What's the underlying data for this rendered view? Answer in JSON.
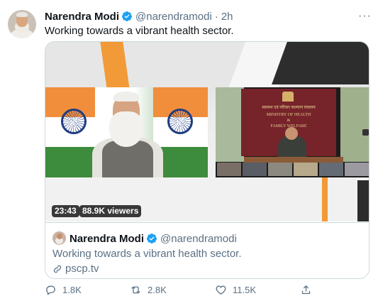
{
  "tweet": {
    "name": "Narendra Modi",
    "handle": "@narendramodi",
    "separator": "·",
    "time": "2h",
    "text": "Working towards a vibrant health sector.",
    "more_label": "···"
  },
  "media": {
    "duration": "23:43",
    "viewers": "88.9K viewers",
    "board_lines": [
      "स्वास्थ्य एवं परिवार कल्याण मंत्रालय",
      "MINISTRY OF HEALTH",
      "&",
      "FAMILY WELFARE"
    ]
  },
  "card": {
    "name": "Narendra Modi",
    "handle": "@narendramodi",
    "text": "Working towards a vibrant health sector.",
    "link": "pscp.tv"
  },
  "actions": {
    "reply": "1.8K",
    "retweet": "2.8K",
    "like": "11.5K"
  },
  "colors": {
    "verified": "#1da1f2",
    "secondary_text": "#5b7083",
    "border": "#cfd9de"
  }
}
